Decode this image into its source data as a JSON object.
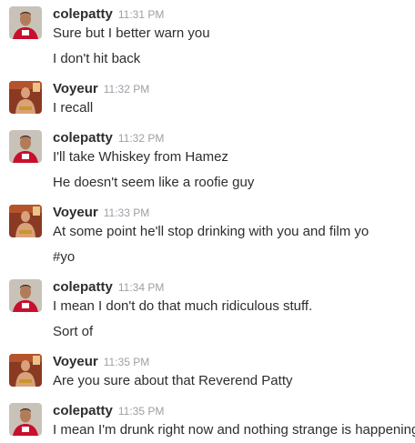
{
  "messages": [
    {
      "author": "colepatty",
      "avatar": "colepatty-avatar",
      "time": "11:31 PM",
      "lines": [
        "Sure but I better warn you",
        "I don't hit back"
      ]
    },
    {
      "author": "Voyeur",
      "avatar": "voyeur-avatar",
      "time": "11:32 PM",
      "lines": [
        "I recall"
      ]
    },
    {
      "author": "colepatty",
      "avatar": "colepatty-avatar",
      "time": "11:32 PM",
      "lines": [
        "I'll take Whiskey from Hamez",
        "He doesn't seem like a roofie guy"
      ]
    },
    {
      "author": "Voyeur",
      "avatar": "voyeur-avatar",
      "time": "11:33 PM",
      "lines": [
        "At some point he'll stop drinking with you and film yo",
        "#yo"
      ]
    },
    {
      "author": "colepatty",
      "avatar": "colepatty-avatar",
      "time": "11:34 PM",
      "lines": [
        "I mean I don't do that much ridiculous stuff.",
        "Sort of"
      ]
    },
    {
      "author": "Voyeur",
      "avatar": "voyeur-avatar",
      "time": "11:35 PM",
      "lines": [
        "Are you sure about that Reverend Patty"
      ]
    },
    {
      "author": "colepatty",
      "avatar": "colepatty-avatar",
      "time": "11:35 PM",
      "lines": [
        "I mean I'm drunk right now and nothing strange is happening"
      ]
    }
  ],
  "colors": {
    "author": "#2c2d30",
    "timestamp": "#9e9ea6",
    "text": "#2c2d30"
  }
}
